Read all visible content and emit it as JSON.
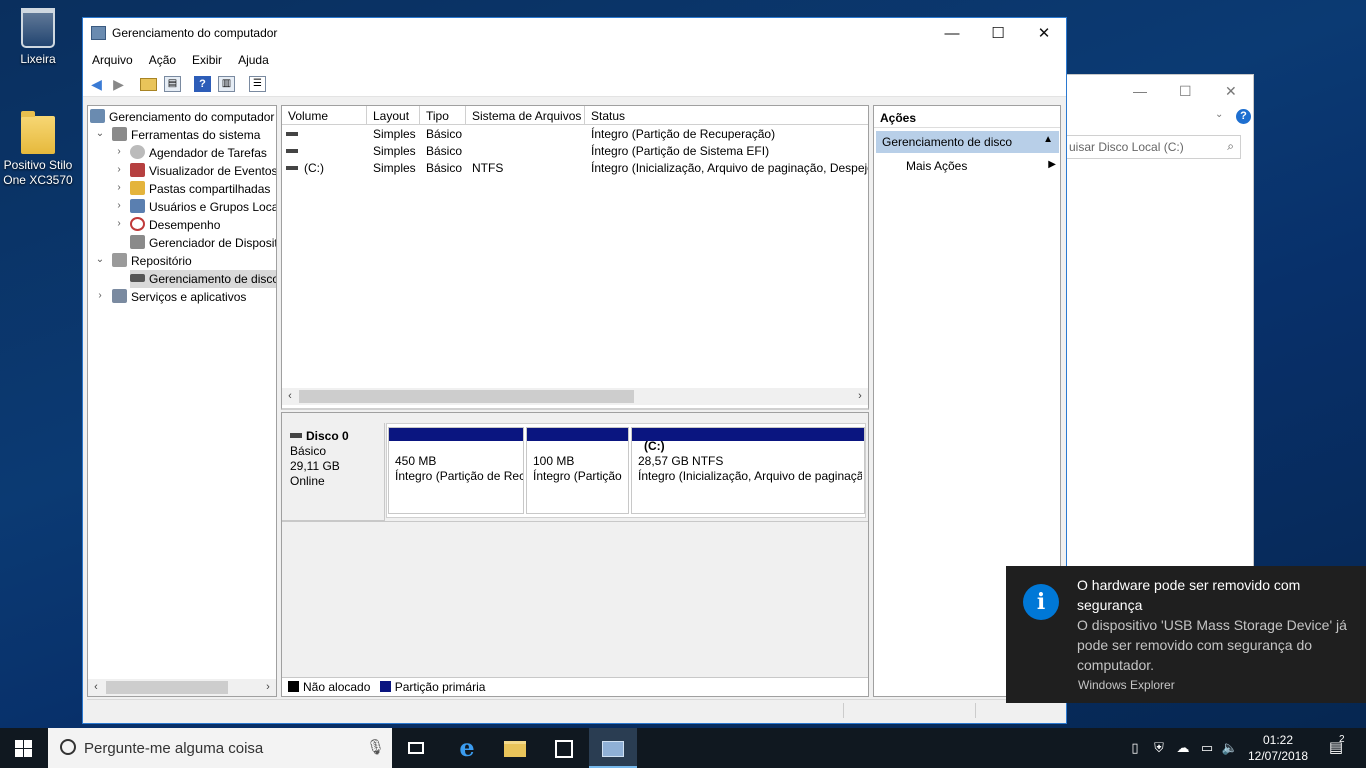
{
  "desktop": {
    "icons": [
      {
        "label": "Lixeira"
      },
      {
        "label": "Positivo Stilo One XC3570"
      }
    ]
  },
  "bg_window": {
    "search_placeholder": "uisar Disco Local (C:)",
    "minimize": "—",
    "maximize": "☐",
    "close": "✕",
    "help": "?"
  },
  "window": {
    "title": "Gerenciamento do computador",
    "controls": {
      "minimize": "—",
      "maximize": "☐",
      "close": "✕"
    },
    "menu": [
      "Arquivo",
      "Ação",
      "Exibir",
      "Ajuda"
    ]
  },
  "tree": {
    "root": "Gerenciamento do computador",
    "items": [
      {
        "label": "Ferramentas do sistema",
        "icon": "tools-icon",
        "color": "#7a7a7a"
      },
      {
        "label": "Agendador de Tarefas",
        "icon": "clock-icon",
        "color": "#9c9c9c"
      },
      {
        "label": "Visualizador de Eventos",
        "icon": "event-viewer-icon",
        "color": "#b64040"
      },
      {
        "label": "Pastas compartilhadas",
        "icon": "shared-folder-icon",
        "color": "#e4b43c"
      },
      {
        "label": "Usuários e Grupos Loca",
        "icon": "users-icon",
        "color": "#5a7fb0"
      },
      {
        "label": "Desempenho",
        "icon": "performance-icon",
        "color": "#c03a3a"
      },
      {
        "label": "Gerenciador de Disposit",
        "icon": "device-manager-icon",
        "color": "#8a8a8a"
      },
      {
        "label": "Repositório",
        "icon": "storage-icon",
        "color": "#8a8a8a"
      },
      {
        "label": "Gerenciamento de disco",
        "icon": "disk-icon",
        "color": "#555555"
      },
      {
        "label": "Serviços e aplicativos",
        "icon": "services-icon",
        "color": "#7a8aa0"
      }
    ]
  },
  "volumes": {
    "columns": [
      "Volume",
      "Layout",
      "Tipo",
      "Sistema de Arquivos",
      "Status"
    ],
    "rows": [
      {
        "volume": "",
        "layout": "Simples",
        "tipo": "Básico",
        "fs": "",
        "status": "Íntegro (Partição de Recuperação)"
      },
      {
        "volume": "",
        "layout": "Simples",
        "tipo": "Básico",
        "fs": "",
        "status": "Íntegro (Partição de Sistema EFI)"
      },
      {
        "volume": "(C:)",
        "layout": "Simples",
        "tipo": "Básico",
        "fs": "NTFS",
        "status": "Íntegro (Inicialização, Arquivo de paginação, Despejo"
      }
    ]
  },
  "disk": {
    "name": "Disco 0",
    "type": "Básico",
    "size": "29,11 GB",
    "state": "Online",
    "partitions": [
      {
        "title": "",
        "size": "450 MB",
        "status": "Íntegro (Partição de Rec"
      },
      {
        "title": "",
        "size": "100 MB",
        "status": "Íntegro (Partição"
      },
      {
        "title": "(C:)",
        "size": "28,57 GB NTFS",
        "status": "Íntegro (Inicialização, Arquivo de paginaçã"
      }
    ],
    "legend": [
      {
        "label": "Não alocado",
        "color": "#000000"
      },
      {
        "label": "Partição primária",
        "color": "#0a1580"
      }
    ]
  },
  "actions": {
    "title": "Ações",
    "selected": "Gerenciamento de disco",
    "more": "Mais Ações"
  },
  "toast": {
    "title": "O hardware pode ser removido com segurança",
    "body": "O dispositivo 'USB Mass Storage Device' já pode ser removido com segurança do computador.",
    "source": "Windows Explorer",
    "icon_glyph": "i"
  },
  "taskbar": {
    "search_placeholder": "Pergunte-me alguma coisa",
    "time": "01:22",
    "date": "12/07/2018",
    "notification_count": "2"
  }
}
